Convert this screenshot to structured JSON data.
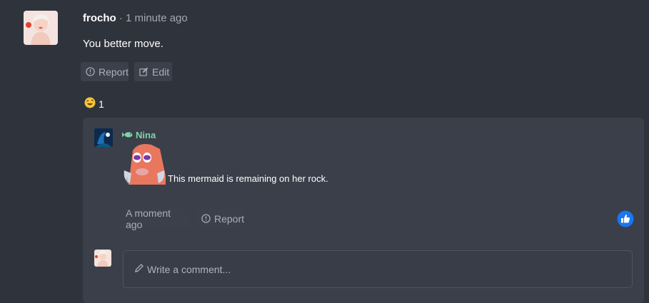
{
  "post": {
    "author": "frocho",
    "meta": " · 1 minute ago",
    "text": "You better move.",
    "report_label": "Report",
    "edit_label": "Edit",
    "reaction_count": "1"
  },
  "reply": {
    "author": "Nina",
    "text": "This mermaid is remaining on her rock.",
    "time_label": "A moment ago",
    "report_label": "Report"
  },
  "comment": {
    "placeholder": "Write a comment..."
  },
  "colors": {
    "background": "#2f333c",
    "reply_background": "#3a3f4a",
    "button_background": "#3b404a",
    "reply_author": "#7fd3a8",
    "like_accent": "#1877f2"
  }
}
